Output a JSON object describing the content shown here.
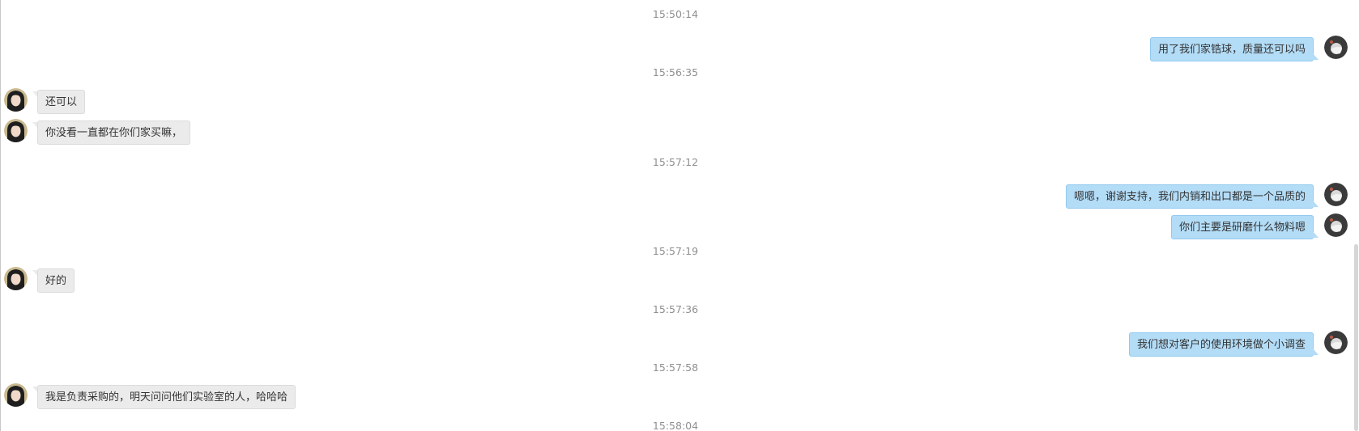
{
  "timestamps": {
    "t1": "15:50:14",
    "t2": "15:56:35",
    "t3": "15:57:12",
    "t4": "15:57:19",
    "t5": "15:57:36",
    "t6": "15:57:58",
    "t7": "15:58:04"
  },
  "messages": {
    "m1": {
      "side": "right",
      "text": "用了我们家锆球，质量还可以吗"
    },
    "m2": {
      "side": "left",
      "text": "还可以"
    },
    "m3": {
      "side": "left",
      "text": "你没看一直都在你们家买嘛，"
    },
    "m4": {
      "side": "right",
      "text": "嗯嗯，谢谢支持，我们内销和出口都是一个品质的"
    },
    "m5": {
      "side": "right",
      "text": "你们主要是研磨什么物料嗯"
    },
    "m6": {
      "side": "left",
      "text": "好的"
    },
    "m7": {
      "side": "right",
      "text": "我们想对客户的使用环境做个小调查"
    },
    "m8": {
      "side": "left",
      "text": "我是负责采购的，明天问问他们实验室的人，哈哈哈"
    }
  },
  "icons": {
    "customer_avatar": "customer-avatar-icon",
    "agent_avatar": "agent-avatar-icon"
  },
  "colors": {
    "own_bubble": "#b3dcf7",
    "other_bubble": "#ebebeb",
    "timestamp_text": "#8f8f8f"
  }
}
